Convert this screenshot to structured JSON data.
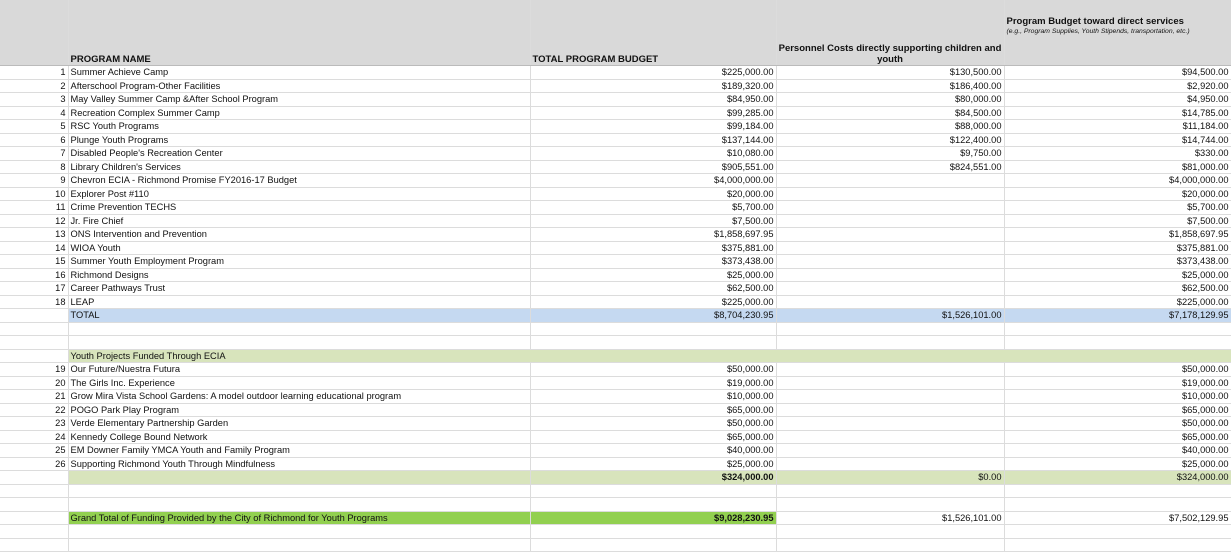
{
  "headers": {
    "program_name": "PROGRAM NAME",
    "total_budget": "TOTAL PROGRAM BUDGET",
    "personnel": "Personnel Costs directly supporting children and youth",
    "program_budget": "Program Budget toward direct services",
    "program_budget_note": "(e.g., Program Supplies, Youth Stipends, transportation, etc.)"
  },
  "programs": [
    {
      "num": "1",
      "name": "Summer Achieve Camp",
      "total": "$225,000.00",
      "personnel": "$130,500.00",
      "direct": "$94,500.00"
    },
    {
      "num": "2",
      "name": "Afterschool Program-Other Facilities",
      "total": "$189,320.00",
      "personnel": "$186,400.00",
      "direct": "$2,920.00"
    },
    {
      "num": "3",
      "name": "May Valley Summer Camp &After School Program",
      "total": "$84,950.00",
      "personnel": "$80,000.00",
      "direct": "$4,950.00"
    },
    {
      "num": "4",
      "name": "Recreation Complex Summer Camp",
      "total": "$99,285.00",
      "personnel": "$84,500.00",
      "direct": "$14,785.00"
    },
    {
      "num": "5",
      "name": "RSC Youth Programs",
      "total": "$99,184.00",
      "personnel": "$88,000.00",
      "direct": "$11,184.00"
    },
    {
      "num": "6",
      "name": "Plunge Youth Programs",
      "total": "$137,144.00",
      "personnel": "$122,400.00",
      "direct": "$14,744.00"
    },
    {
      "num": "7",
      "name": "Disabled People's Recreation Center",
      "total": "$10,080.00",
      "personnel": "$9,750.00",
      "direct": "$330.00"
    },
    {
      "num": "8",
      "name": "Library Children's Services",
      "total": "$905,551.00",
      "personnel": "$824,551.00",
      "direct": "$81,000.00"
    },
    {
      "num": "9",
      "name": "Chevron ECIA - Richmond Promise FY2016-17  Budget",
      "total": "$4,000,000.00",
      "personnel": "",
      "direct": "$4,000,000.00"
    },
    {
      "num": "10",
      "name": "Explorer Post #110",
      "total": "$20,000.00",
      "personnel": "",
      "direct": "$20,000.00"
    },
    {
      "num": "11",
      "name": "Crime Prevention TECHS",
      "total": "$5,700.00",
      "personnel": "",
      "direct": "$5,700.00"
    },
    {
      "num": "12",
      "name": "Jr. Fire Chief",
      "total": "$7,500.00",
      "personnel": "",
      "direct": "$7,500.00"
    },
    {
      "num": "13",
      "name": "ONS Intervention and Prevention",
      "total": "$1,858,697.95",
      "personnel": "",
      "direct": "$1,858,697.95"
    },
    {
      "num": "14",
      "name": "WIOA Youth",
      "total": "$375,881.00",
      "personnel": "",
      "direct": "$375,881.00"
    },
    {
      "num": "15",
      "name": "Summer Youth Employment Program",
      "total": "$373,438.00",
      "personnel": "",
      "direct": "$373,438.00"
    },
    {
      "num": "16",
      "name": "Richmond Designs",
      "total": "$25,000.00",
      "personnel": "",
      "direct": "$25,000.00"
    },
    {
      "num": "17",
      "name": "Career Pathways Trust",
      "total": "$62,500.00",
      "personnel": "",
      "direct": "$62,500.00"
    },
    {
      "num": "18",
      "name": "LEAP",
      "total": "$225,000.00",
      "personnel": "",
      "direct": "$225,000.00"
    }
  ],
  "total_row": {
    "label": "TOTAL",
    "total": "$8,704,230.95",
    "personnel": "$1,526,101.00",
    "direct": "$7,178,129.95"
  },
  "ecia_section": {
    "title": "Youth Projects Funded Through ECIA"
  },
  "ecia_projects": [
    {
      "num": "19",
      "name": "Our Future/Nuestra Futura",
      "total": "$50,000.00",
      "direct": "$50,000.00"
    },
    {
      "num": "20",
      "name": "The Girls Inc. Experience",
      "total": "$19,000.00",
      "direct": "$19,000.00"
    },
    {
      "num": "21",
      "name": "Grow Mira Vista School Gardens: A model outdoor learning educational program",
      "total": "$10,000.00",
      "direct": "$10,000.00"
    },
    {
      "num": "22",
      "name": "POGO Park Play Program",
      "total": "$65,000.00",
      "direct": "$65,000.00"
    },
    {
      "num": "23",
      "name": "Verde Elementary Partnership Garden",
      "total": "$50,000.00",
      "direct": "$50,000.00"
    },
    {
      "num": "24",
      "name": "Kennedy College Bound Network",
      "total": "$65,000.00",
      "direct": "$65,000.00"
    },
    {
      "num": "25",
      "name": "EM Downer Family YMCA Youth and Family Program",
      "total": "$40,000.00",
      "direct": "$40,000.00"
    },
    {
      "num": "26",
      "name": "Supporting Richmond Youth Through Mindfulness",
      "total": "$25,000.00",
      "direct": "$25,000.00"
    }
  ],
  "ecia_subtotal": {
    "total": "$324,000.00",
    "personnel": "$0.00",
    "direct": "$324,000.00"
  },
  "grand_total": {
    "label": "Grand Total of Funding Provided by the City of Richmond for Youth Programs",
    "total": "$9,028,230.95",
    "personnel": "$1,526,101.00",
    "direct": "$7,502,129.95"
  },
  "colors": {
    "header": "#d9d9d9",
    "total": "#c5d9f1",
    "section": "#d8e4bc",
    "grand": "#92d050"
  }
}
